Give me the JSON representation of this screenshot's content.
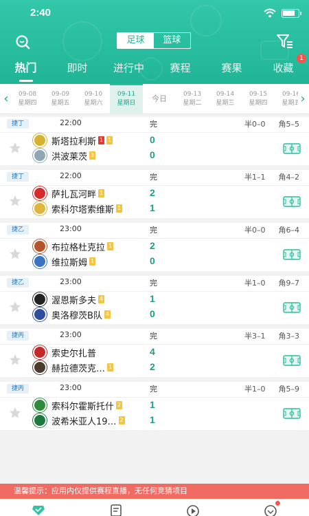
{
  "status_bar": {
    "time": "2:40",
    "battery_level": 0.8
  },
  "header": {
    "sport_tabs": [
      {
        "label": "足球",
        "active": true
      },
      {
        "label": "篮球",
        "active": false
      }
    ],
    "tabs": [
      {
        "label": "热门",
        "active": true
      },
      {
        "label": "即时",
        "active": false
      },
      {
        "label": "进行中",
        "active": false
      },
      {
        "label": "赛程",
        "active": false
      },
      {
        "label": "赛果",
        "active": false
      },
      {
        "label": "收藏",
        "active": false,
        "badge": "1"
      }
    ],
    "accent_color": "#22b595"
  },
  "dates": [
    {
      "date": "09-08",
      "weekday": "星期四"
    },
    {
      "date": "09-09",
      "weekday": "星期五"
    },
    {
      "date": "09-10",
      "weekday": "星期六"
    },
    {
      "date": "09-11",
      "weekday": "星期日",
      "active": true
    },
    {
      "date": "今日",
      "weekday": "",
      "today": true
    },
    {
      "date": "09-13",
      "weekday": "星期二"
    },
    {
      "date": "09-14",
      "weekday": "星期三"
    },
    {
      "date": "09-15",
      "weekday": "星期四"
    },
    {
      "date": "09-16",
      "weekday": "星期五"
    }
  ],
  "matches": [
    {
      "league": "捷丁",
      "time": "22:00",
      "status": "完",
      "half": "半0–0",
      "corner": "角5–5",
      "home": {
        "name": "斯塔拉利斯",
        "logo_color": "#d8b12e",
        "cards": [
          {
            "type": "r",
            "n": "1"
          },
          {
            "type": "y",
            "n": "1"
          }
        ]
      },
      "away": {
        "name": "洪波莱茨",
        "logo_color": "#8fa7b8",
        "cards": [
          {
            "type": "y",
            "n": "3"
          }
        ]
      },
      "home_score": "0",
      "away_score": "0"
    },
    {
      "league": "捷丁",
      "time": "22:00",
      "status": "完",
      "half": "半1–1",
      "corner": "角4–2",
      "home": {
        "name": "萨扎瓦河畔",
        "logo_color": "#d62b2b",
        "cards": [
          {
            "type": "y",
            "n": "1"
          }
        ]
      },
      "away": {
        "name": "索科尔塔索维斯",
        "logo_color": "#e0b53b",
        "cards": [
          {
            "type": "y",
            "n": "1"
          }
        ]
      },
      "home_score": "2",
      "away_score": "1"
    },
    {
      "league": "捷乙",
      "time": "23:00",
      "status": "完",
      "half": "半0–0",
      "corner": "角6–4",
      "home": {
        "name": "布拉格杜克拉",
        "logo_color": "#b5542a",
        "cards": [
          {
            "type": "y",
            "n": "1"
          }
        ]
      },
      "away": {
        "name": "维拉斯姆",
        "logo_color": "#3a73c2",
        "cards": [
          {
            "type": "y",
            "n": "1"
          }
        ]
      },
      "home_score": "2",
      "away_score": "0"
    },
    {
      "league": "捷乙",
      "time": "23:00",
      "status": "完",
      "half": "半1–0",
      "corner": "角9–7",
      "home": {
        "name": "渥恩斯多夫",
        "logo_color": "#222222",
        "cards": [
          {
            "type": "y",
            "n": "4"
          }
        ]
      },
      "away": {
        "name": "奥洛穆茨B队",
        "logo_color": "#2d4f9e",
        "cards": [
          {
            "type": "y",
            "n": "4"
          }
        ]
      },
      "home_score": "1",
      "away_score": "0"
    },
    {
      "league": "捷丙",
      "time": "23:00",
      "status": "完",
      "half": "半3–1",
      "corner": "角3–3",
      "home": {
        "name": "索史尔扎普",
        "logo_color": "#c42828",
        "cards": []
      },
      "away": {
        "name": "赫拉德茨克…",
        "logo_color": "#4a3b2a",
        "cards": [
          {
            "type": "y",
            "n": "1"
          }
        ]
      },
      "home_score": "4",
      "away_score": "2"
    },
    {
      "league": "捷丙",
      "time": "23:00",
      "status": "完",
      "half": "半1–0",
      "corner": "角5–9",
      "home": {
        "name": "索科尔霍斯托什",
        "logo_color": "#2e8b3c",
        "cards": [
          {
            "type": "y",
            "n": "2"
          }
        ]
      },
      "away": {
        "name": "波希米亚人19…",
        "logo_color": "#1e7a3c",
        "cards": [
          {
            "type": "y",
            "n": "2"
          }
        ]
      },
      "home_score": "1",
      "away_score": "1"
    }
  ],
  "notice": "温馨提示：应用内仅提供赛程直播，无任何竞猜项目",
  "bottom_nav": [
    {
      "icon": "home-icon",
      "active": true
    },
    {
      "icon": "news-icon"
    },
    {
      "icon": "play-icon"
    },
    {
      "icon": "profile-icon",
      "dot": true
    }
  ]
}
